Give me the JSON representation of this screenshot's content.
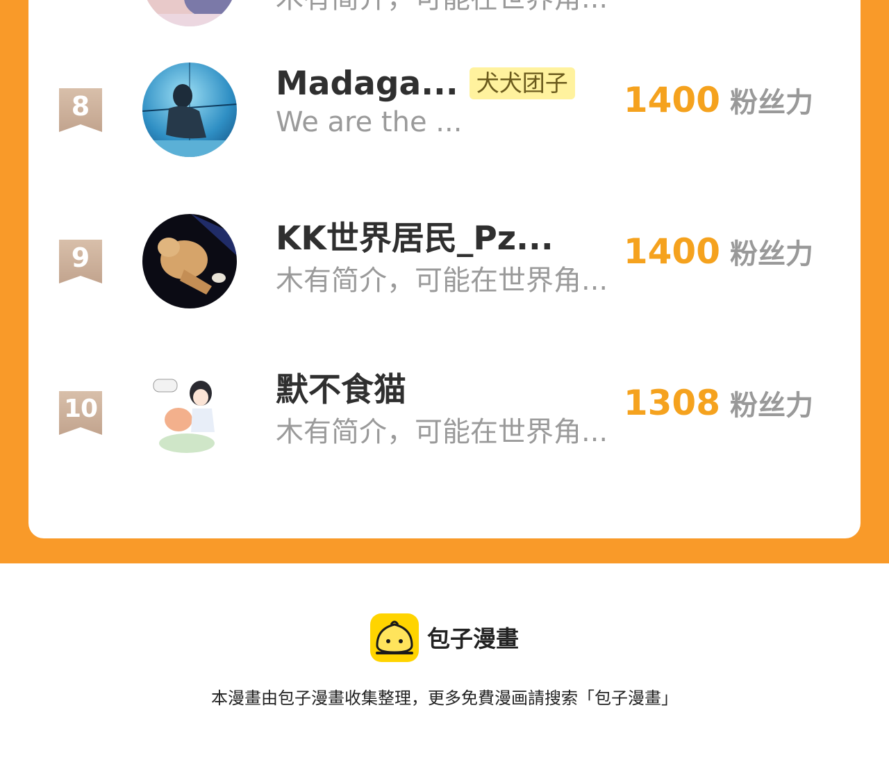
{
  "theme": {
    "accent": "#F99A29",
    "count_color": "#F5A21E",
    "tag_bg": "#FFF29E",
    "badge_color": "#C9AE98"
  },
  "rows": [
    {
      "rank": "",
      "name": "",
      "tag": "",
      "bio": "木有简介，可能在世界角...",
      "count": "",
      "unit": ""
    },
    {
      "rank": "8",
      "name": "Madaga...",
      "tag": "犬犬团子",
      "bio": "We are the ...",
      "count": "1400",
      "unit": "粉丝力",
      "avatar": "aquarium-photo"
    },
    {
      "rank": "9",
      "name": "KK世界居民_Pz...",
      "tag": "",
      "bio": "木有简介，可能在世界角...",
      "count": "1400",
      "unit": "粉丝力",
      "avatar": "cat-photo"
    },
    {
      "rank": "10",
      "name": "默不食猫",
      "tag": "",
      "bio": "木有简介，可能在世界角...",
      "count": "1308",
      "unit": "粉丝力",
      "avatar": "anime-drawing"
    }
  ],
  "footer": {
    "logo_icon": "bun-face-icon",
    "brand": "包子漫畫",
    "note": "本漫畫由包子漫畫收集整理，更多免費漫画請搜索「包子漫畫」"
  }
}
